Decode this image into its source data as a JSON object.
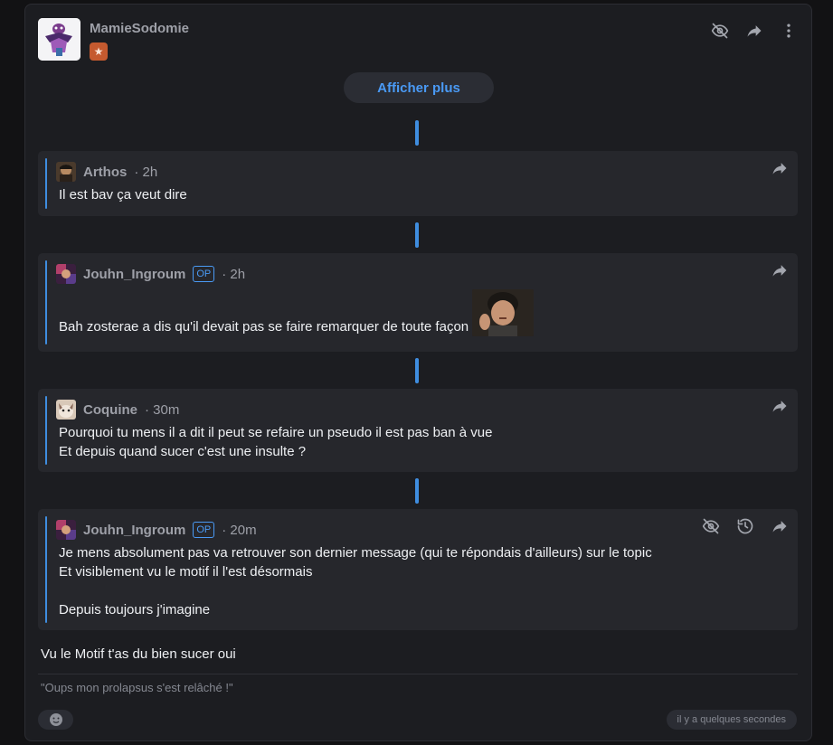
{
  "post": {
    "username": "MamieSodomie",
    "badge_icon": "star-badge-icon",
    "actions": [
      "hide-icon",
      "share-icon",
      "more-vertical-icon"
    ]
  },
  "show_more_label": "Afficher plus",
  "quotes": [
    {
      "user": "Arthos",
      "op": "",
      "time": "· 2h",
      "lines": [
        "Il est bav ça veut dire"
      ]
    },
    {
      "user": "Jouhn_Ingroum",
      "op": "OP",
      "time": "· 2h",
      "lines": [
        "Bah zosterae a dis qu'il devait pas se faire remarquer de toute façon"
      ],
      "has_sticker": true
    },
    {
      "user": "Coquine",
      "op": "",
      "time": "· 30m",
      "lines": [
        "Pourquoi tu mens il a dit il peut se refaire un pseudo il est pas ban à vue",
        "Et depuis quand sucer c'est une insulte ?"
      ]
    },
    {
      "user": "Jouhn_Ingroum",
      "op": "OP",
      "time": "· 20m",
      "lines": [
        "Je mens absolument pas va retrouver son dernier message (qui te répondais d'ailleurs) sur le topic",
        "Et visiblement vu le motif il l'est désormais",
        "",
        "Depuis toujours j'imagine"
      ],
      "extra_icons": [
        "hide-icon",
        "history-icon",
        "share-icon"
      ]
    }
  ],
  "reply_text": "Vu le Motif t'as du bien sucer oui",
  "signature": "\"Oups mon prolapsus s'est relâché !\"",
  "timestamp": "il y a quelques secondes",
  "colors": {
    "accent": "#4a9af5",
    "connector": "#3f8ddf",
    "badge": "#c55a2f",
    "card_bg": "#1c1d21",
    "quote_bg": "#26272c"
  }
}
